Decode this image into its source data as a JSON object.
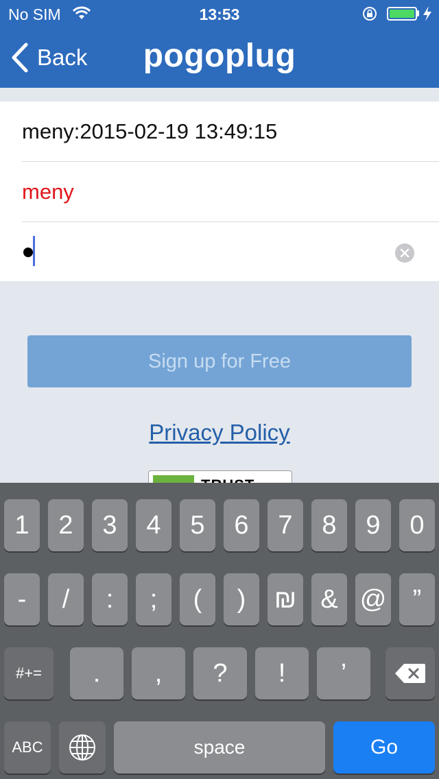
{
  "status_bar": {
    "carrier": "No SIM",
    "time": "13:53",
    "icons": [
      "wifi-icon",
      "rotation-lock-icon",
      "battery-icon",
      "charging-bolt-icon"
    ],
    "battery_color": "#4cd964"
  },
  "navbar": {
    "back_label": "Back",
    "logo": "pogoplug",
    "color": "#2d6bbd"
  },
  "form": {
    "email_value": "meny:2015-02-19 13:49:15",
    "username_value": "meny",
    "password_masked": "•"
  },
  "signup_button": {
    "label": "Sign up for Free"
  },
  "privacy_link": {
    "label": "Privacy Policy"
  },
  "trust_badge": {
    "text": "TRUST"
  },
  "keyboard": {
    "row1": [
      "1",
      "2",
      "3",
      "4",
      "5",
      "6",
      "7",
      "8",
      "9",
      "0"
    ],
    "row2": [
      "-",
      "/",
      ":",
      ";",
      "(",
      ")",
      "₪",
      "&",
      "@",
      "”"
    ],
    "row3_left": "#+=",
    "row3": [
      ".",
      ",",
      "?",
      "!",
      "’"
    ],
    "abc": "ABC",
    "space": "space",
    "go": "Go",
    "go_color": "#1a7ff3"
  }
}
